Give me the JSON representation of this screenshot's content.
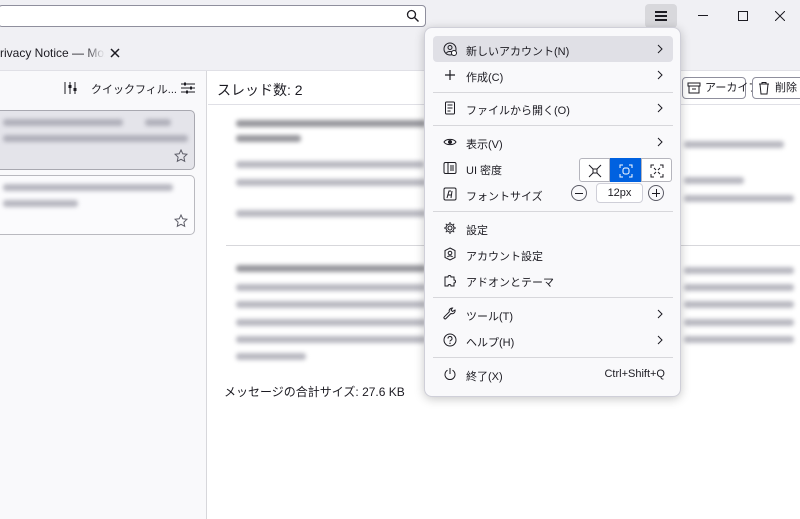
{
  "titlebar": {
    "search_value": "",
    "icons": {
      "search": "search-icon",
      "menu": "hamburger-menu-icon"
    },
    "window_controls": [
      "minimize-icon",
      "maximize-icon",
      "close-icon"
    ]
  },
  "tab": {
    "title": "rivacy Notice — Mozilla",
    "close_icon": "close-icon"
  },
  "thread_pane": {
    "quick_filter_label": "クイックフィル...",
    "cards": [
      {
        "selected": true,
        "starred": false
      },
      {
        "selected": false,
        "starred": false
      }
    ]
  },
  "message_pane": {
    "thread_count": "スレッド数: 2",
    "archive_label": "アーカイブ",
    "delete_label": "削除",
    "total_size": "メッセージの合計サイズ: 27.6 KB"
  },
  "app_menu": {
    "items": [
      {
        "label": "新しいアカウント(N)",
        "icon": "new-account-icon",
        "submenu": true,
        "hover": true
      },
      {
        "label": "作成(C)",
        "icon": "plus-icon",
        "submenu": true
      },
      {
        "label": "ファイルから開く(O)",
        "icon": "file-icon",
        "submenu": true
      },
      {
        "label": "表示(V)",
        "icon": "eye-icon",
        "submenu": true
      },
      {
        "label": "UI 密度",
        "icon": "density-icon"
      },
      {
        "label": "フォントサイズ",
        "icon": "font-size-icon"
      },
      {
        "label": "設定",
        "icon": "gear-icon"
      },
      {
        "label": "アカウント設定",
        "icon": "account-settings-icon"
      },
      {
        "label": "アドオンとテーマ",
        "icon": "puzzle-icon"
      },
      {
        "label": "ツール(T)",
        "icon": "wrench-icon",
        "submenu": true
      },
      {
        "label": "ヘルプ(H)",
        "icon": "help-icon",
        "submenu": true
      },
      {
        "label": "終了(X)",
        "icon": "power-icon",
        "shortcut": "Ctrl+Shift+Q"
      }
    ],
    "density_selected": "normal",
    "font_size": "12px"
  },
  "colors": {
    "accent": "#0061e0",
    "menu_bg": "#f9f9fb",
    "hover_bg": "#e0e0e6"
  }
}
